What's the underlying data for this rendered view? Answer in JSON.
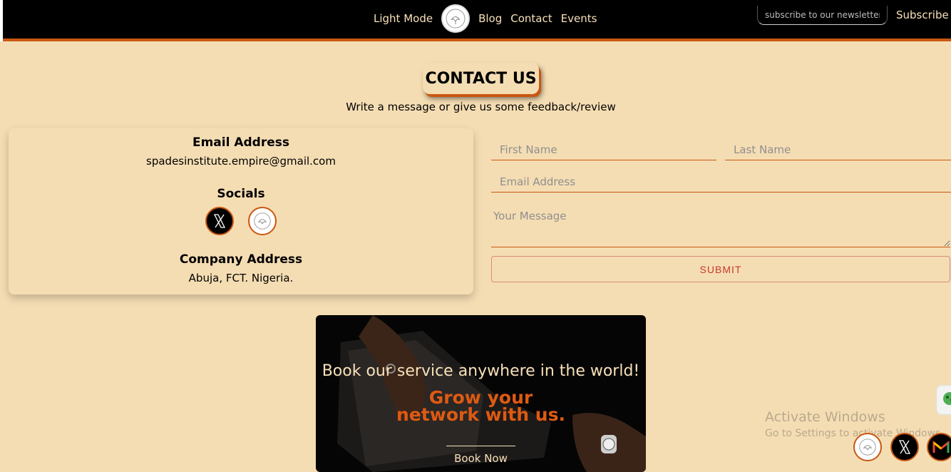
{
  "nav": {
    "links": [
      "Light Mode",
      "Blog",
      "Contact",
      "Events"
    ],
    "newsletter_placeholder": "subscribe to our newsletter",
    "subscribe_label": "Subscribe",
    "accent_color": "#c85712"
  },
  "contact": {
    "title": "CONTACT US",
    "subtitle": "Write a message or give us some feedback/review"
  },
  "info": {
    "email_heading": "Email Address",
    "email": "spadesinstitute.empire@gmail.com",
    "socials_heading": "Socials",
    "socials": [
      "x-icon",
      "logo-icon"
    ],
    "address_heading": "Company Address",
    "address": "Abuja, FCT. Nigeria."
  },
  "form": {
    "first_name_placeholder": "First Name",
    "last_name_placeholder": "Last Name",
    "email_placeholder": "Email Address",
    "message_placeholder": "Your Message",
    "submit_label": "SUBMIT"
  },
  "banner": {
    "tagline": "Book our service anywhere in the world!",
    "headline_1": "Grow your",
    "headline_2": "network with us.",
    "cta": "Book Now"
  },
  "watermark": {
    "line1": "Activate Windows",
    "line2": "Go to Settings to activate Windows."
  },
  "floating_icons": [
    "logo-icon",
    "x-icon",
    "gmail-icon"
  ]
}
